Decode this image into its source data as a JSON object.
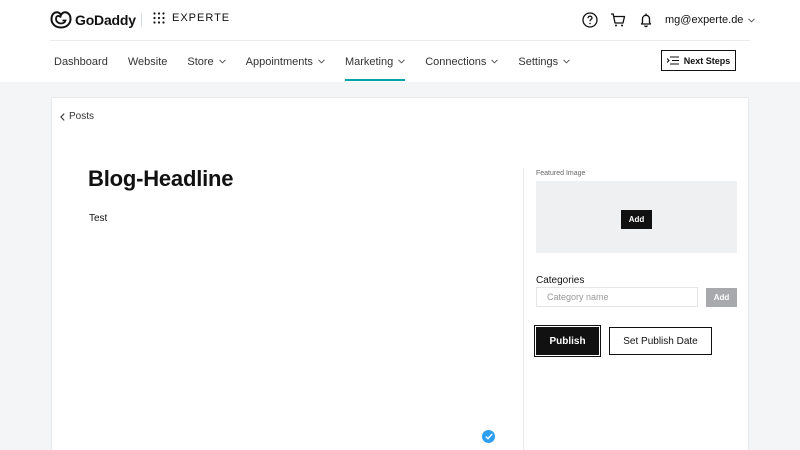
{
  "brand": {
    "name": "GoDaddy"
  },
  "site": {
    "name": "EXPERTE"
  },
  "account": {
    "email": "mg@experte.de"
  },
  "nav": {
    "items": [
      {
        "label": "Dashboard",
        "has_menu": false,
        "active": false
      },
      {
        "label": "Website",
        "has_menu": false,
        "active": false
      },
      {
        "label": "Store",
        "has_menu": true,
        "active": false
      },
      {
        "label": "Appointments",
        "has_menu": true,
        "active": false
      },
      {
        "label": "Marketing",
        "has_menu": true,
        "active": true
      },
      {
        "label": "Connections",
        "has_menu": true,
        "active": false
      },
      {
        "label": "Settings",
        "has_menu": true,
        "active": false
      }
    ],
    "next_steps_label": "Next Steps"
  },
  "breadcrumb": {
    "back_label": "Posts"
  },
  "post": {
    "headline": "Blog-Headline",
    "body": "Test"
  },
  "sidebar": {
    "featured_image_label": "Featured Image",
    "featured_image_add": "Add",
    "categories_label": "Categories",
    "category_placeholder": "Category name",
    "category_add": "Add",
    "publish_label": "Publish",
    "set_publish_date_label": "Set Publish Date"
  },
  "icons": {
    "help": "help-circle-icon",
    "cart": "cart-icon",
    "notifications": "bell-icon",
    "apps": "grid-dots-icon",
    "back": "chevron-left-icon",
    "next_steps": "list-steps-icon",
    "status": "check-circle-icon"
  },
  "colors": {
    "accent": "#00a4a6",
    "primary_button": "#111111",
    "disabled_button": "#a7a9ac",
    "status_check": "#2e9ff0",
    "page_background": "#f4f5f6"
  }
}
